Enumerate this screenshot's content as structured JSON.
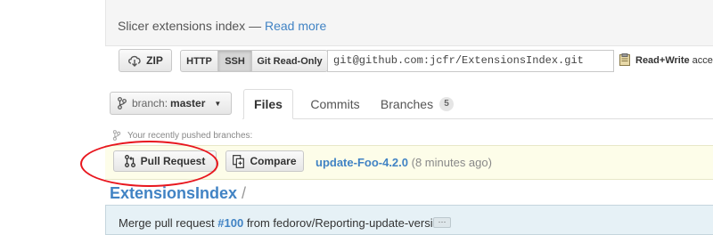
{
  "description": {
    "text": "Slicer extensions index — ",
    "read_more": "Read more"
  },
  "clone": {
    "zip_label": "ZIP",
    "protocols": [
      "HTTP",
      "SSH",
      "Git Read-Only"
    ],
    "active_protocol": "SSH",
    "url": "git@github.com:jcfr/ExtensionsIndex.git",
    "access_bold": "Read+Write",
    "access_rest": " acces"
  },
  "branch": {
    "label": "branch:",
    "value": "master"
  },
  "tabs": [
    {
      "label": "Files",
      "active": true
    },
    {
      "label": "Commits"
    },
    {
      "label": "Branches",
      "count": "5"
    }
  ],
  "recent": {
    "label": "Your recently pushed branches:",
    "pull_request_label": "Pull Request",
    "compare_label": "Compare",
    "branch_name": "update-Foo-4.2.0",
    "time": " (8 minutes ago)"
  },
  "breadcrumb": {
    "repo": "ExtensionsIndex",
    "sep": " /"
  },
  "commit": {
    "prefix": "Merge pull request ",
    "pr_number": "#100",
    "suffix": " from fedorov/Reporting-update-version",
    "ellipsis": "···"
  },
  "colors": {
    "link": "#4183c4",
    "annotation": "#e8161e",
    "highlight": "#fdfde9"
  }
}
